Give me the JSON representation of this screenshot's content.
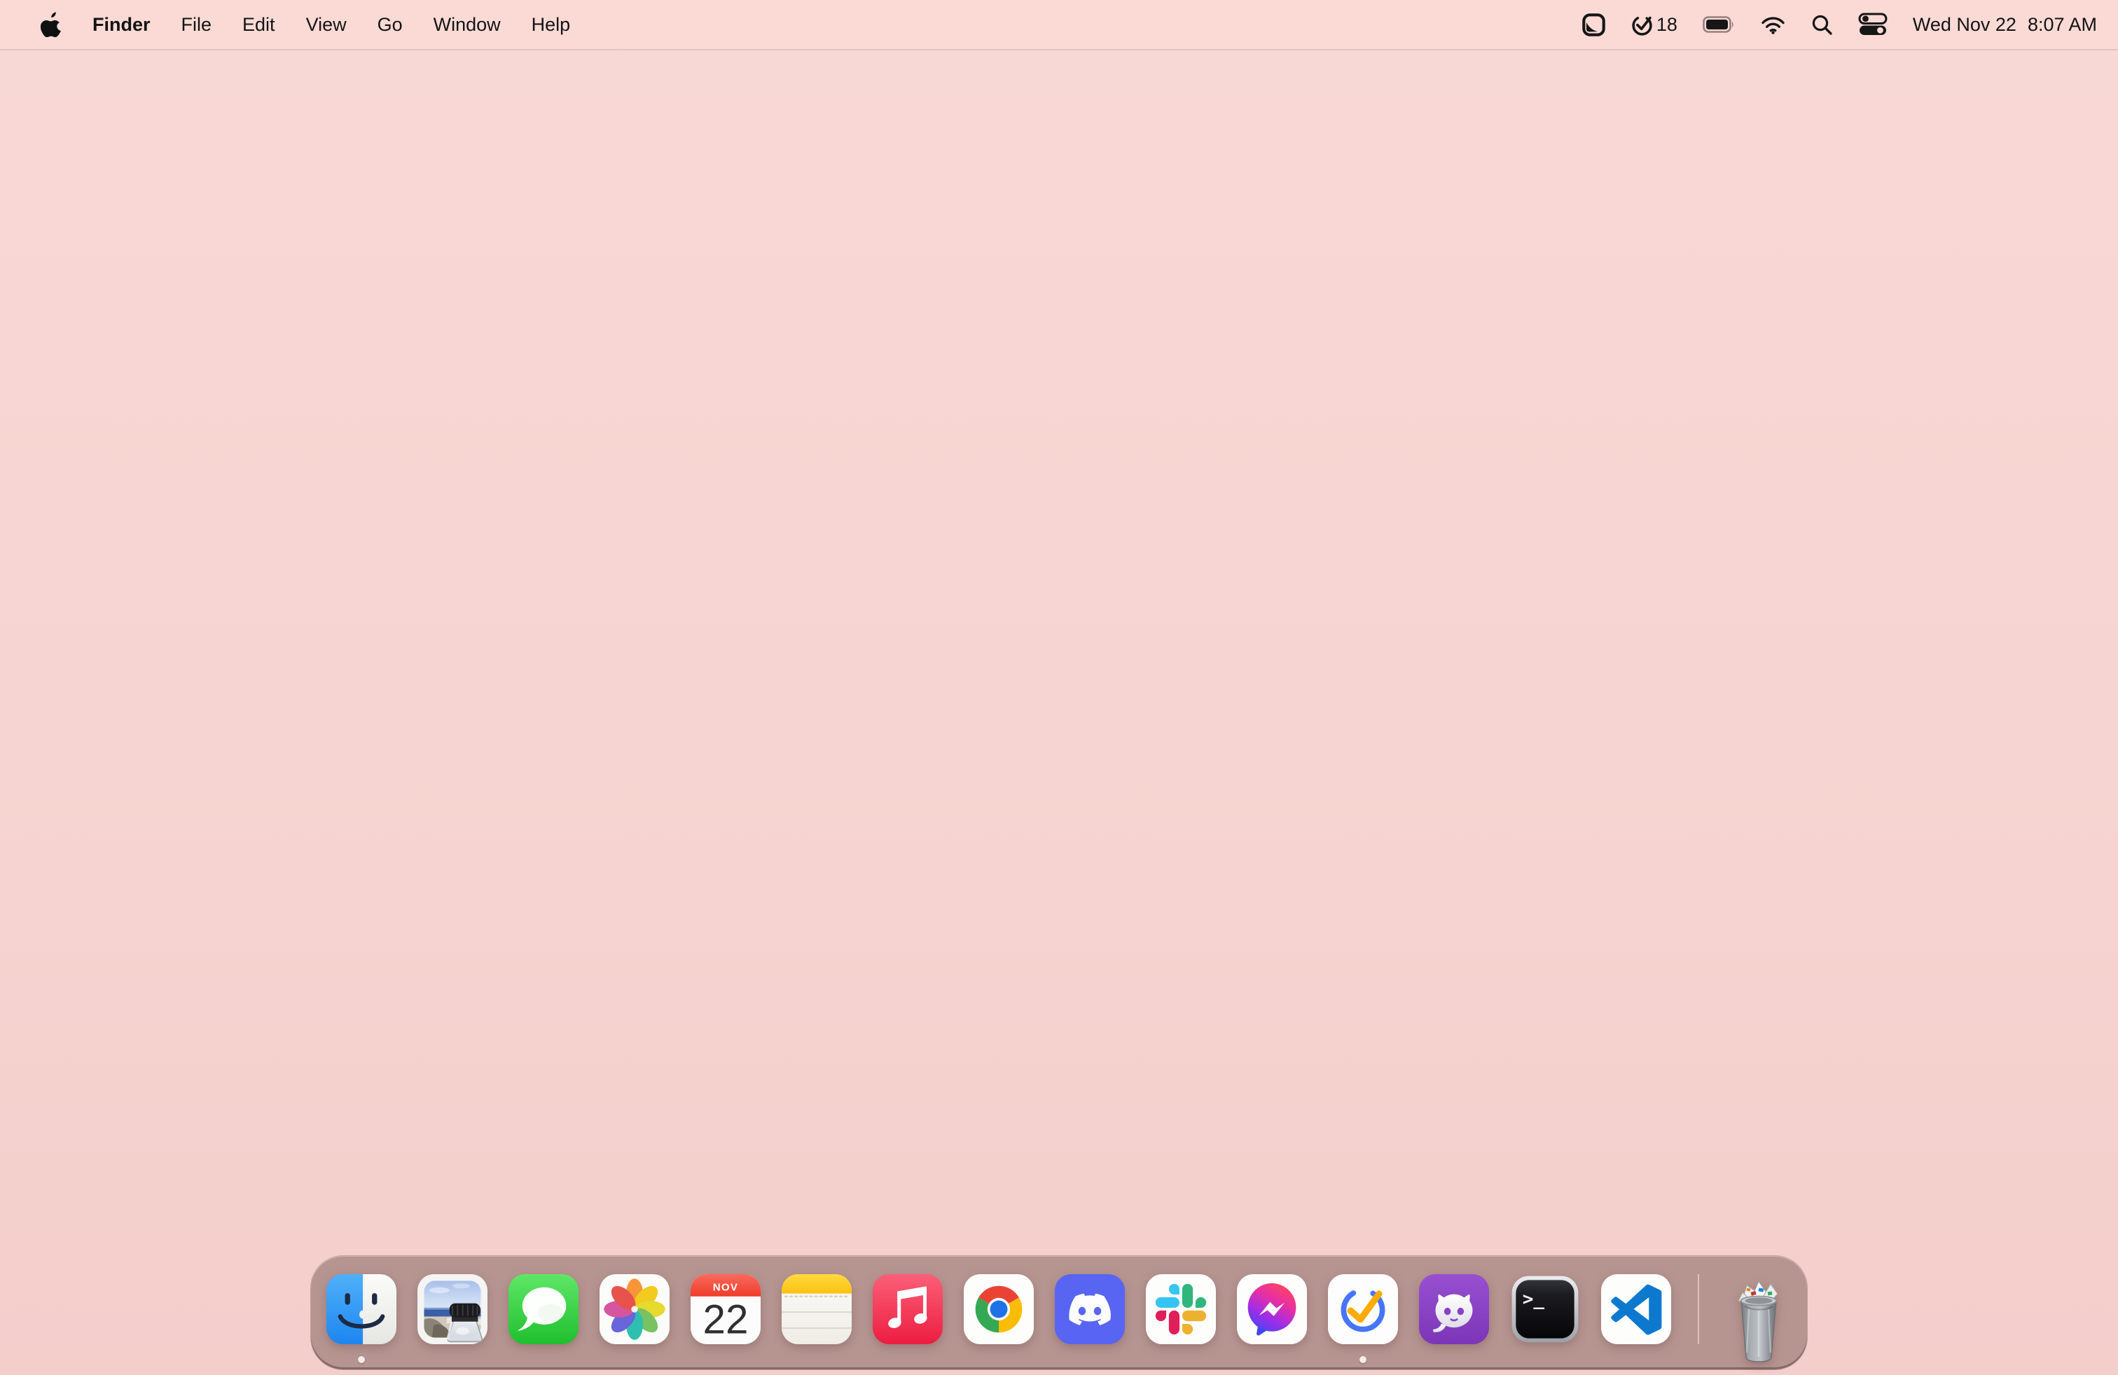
{
  "menu_bar": {
    "app_name": "Finder",
    "menus": [
      "File",
      "Edit",
      "View",
      "Go",
      "Window",
      "Help"
    ],
    "status": {
      "task_count": "18",
      "icons": [
        "screenshot-flap-icon",
        "ticktick-progress-icon",
        "battery-icon",
        "wifi-icon",
        "spotlight-search-icon",
        "control-center-icon"
      ]
    },
    "clock": {
      "date": "Wed Nov 22",
      "time": "8:07 AM"
    }
  },
  "dock": {
    "apps": [
      {
        "name": "Finder",
        "running": true
      },
      {
        "name": "Preview",
        "running": false
      },
      {
        "name": "Messages",
        "running": false
      },
      {
        "name": "Photos",
        "running": false
      },
      {
        "name": "Calendar",
        "running": false
      },
      {
        "name": "Notes",
        "running": false
      },
      {
        "name": "Music",
        "running": false
      },
      {
        "name": "Google Chrome",
        "running": false
      },
      {
        "name": "Discord",
        "running": false
      },
      {
        "name": "Slack",
        "running": false
      },
      {
        "name": "Messenger",
        "running": false
      },
      {
        "name": "TickTick",
        "running": true
      },
      {
        "name": "GitHub Desktop",
        "running": false
      },
      {
        "name": "Terminal",
        "running": false
      },
      {
        "name": "Visual Studio Code",
        "running": false
      }
    ],
    "calendar": {
      "month": "NOV",
      "day": "22"
    },
    "terminal_glyph": ">_",
    "trash": {
      "name": "Trash",
      "state": "full"
    }
  },
  "colors": {
    "wallpaper": "#F6D3D0",
    "menu_bar": "#FBDAD6",
    "dock": "#B19390",
    "indicator": "#F4ECEA",
    "text": "#141414"
  }
}
